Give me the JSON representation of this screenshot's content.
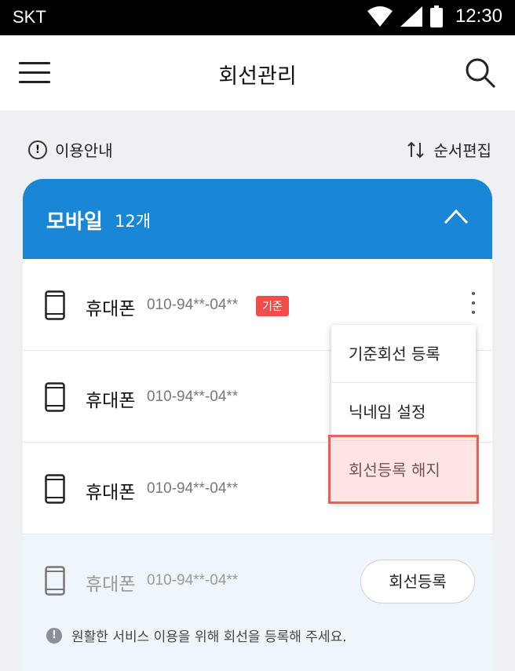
{
  "status_bar": {
    "carrier": "SKT",
    "time": "12:30"
  },
  "app_bar": {
    "title": "회선관리"
  },
  "toolbar": {
    "guide_label": "이용안내",
    "reorder_label": "순서편집"
  },
  "group": {
    "name": "모바일",
    "count": "12개"
  },
  "lines": [
    {
      "label": "휴대폰",
      "number": "010-94**-04**",
      "badge": "기준"
    },
    {
      "label": "휴대폰",
      "number": "010-94**-04**"
    },
    {
      "label": "휴대폰",
      "number": "010-94**-04**"
    }
  ],
  "unregistered": {
    "label": "휴대폰",
    "number": "010-94**-04**",
    "register_button": "회선등록",
    "notice": "원활한 서비스 이용을 위해 회선을 등록해 주세요."
  },
  "context_menu": {
    "items": [
      "기준회선 등록",
      "닉네임 설정",
      "회선등록 해지"
    ],
    "highlighted_index": 2
  },
  "colors": {
    "accent": "#1a86d6",
    "badge": "#ef4e4a",
    "highlight": "#e8605a"
  }
}
